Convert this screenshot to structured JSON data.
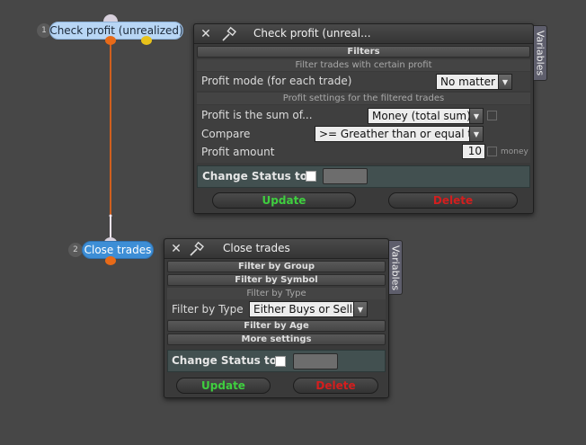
{
  "colors": {
    "background": "#474747",
    "connector": "#d05f1e",
    "connector_light": "#f2e4ef",
    "node1_fill": "#b8d6f5",
    "node2_fill": "#3d8ed6",
    "port_orange": "#e86a18",
    "port_yellow": "#e8c21a",
    "update_text": "#3fcf3f",
    "delete_text": "#d41e1e"
  },
  "nodes": [
    {
      "number": "1",
      "label": "Check profit (unrealized)"
    },
    {
      "number": "2",
      "label": "Close trades"
    }
  ],
  "panel1": {
    "close_icon": "close-icon",
    "pin_icon": "pin-icon",
    "title": "Check profit (unreal...",
    "variables_tab": "Variables",
    "section_filters": "Filters",
    "sub_filter_trades": "Filter trades with certain profit",
    "profit_mode_label": "Profit mode (for each trade)",
    "profit_mode_value": "No matter",
    "sub_profit_settings": "Profit settings for the filtered trades",
    "profit_sum_label": "Profit is the sum of...",
    "profit_sum_value": "Money (total sum)",
    "compare_label": "Compare",
    "compare_value": ">= Greather than or equal to",
    "profit_amount_label": "Profit amount",
    "profit_amount_value": "10",
    "money_label": "money",
    "change_status_label": "Change Status to",
    "update_label": "Update",
    "delete_label": "Delete"
  },
  "panel2": {
    "close_icon": "close-icon",
    "pin_icon": "pin-icon",
    "title": "Close trades",
    "variables_tab": "Variables",
    "section_group": "Filter by Group",
    "section_symbol": "Filter by Symbol",
    "sub_type": "Filter by Type",
    "filter_type_label": "Filter by Type",
    "filter_type_value": "Either Buys or Sells",
    "section_age": "Filter by Age",
    "section_more": "More settings",
    "change_status_label": "Change Status to",
    "update_label": "Update",
    "delete_label": "Delete"
  }
}
